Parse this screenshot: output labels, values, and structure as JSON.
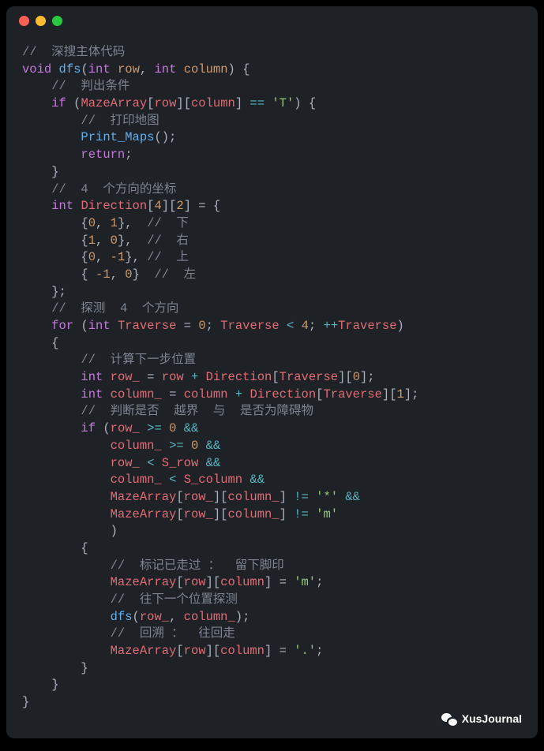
{
  "watermark": "XusJournal",
  "code": {
    "c1": "//  深搜主体代码",
    "l2_void": "void",
    "l2_dfs": "dfs",
    "l2_int1": "int",
    "l2_row": "row",
    "l2_int2": "int",
    "l2_col": "column",
    "c3": "//  判出条件",
    "l4_if": "if",
    "l4_maze": "MazeArray",
    "l4_row": "row",
    "l4_col": "column",
    "l4_eq": "==",
    "l4_t": "'T'",
    "c5": "//  打印地图",
    "l6_print": "Print_Maps",
    "l7_return": "return",
    "c9": "//  4  个方向的坐标",
    "l10_int": "int",
    "l10_dir": "Direction",
    "l10_4": "4",
    "l10_2": "2",
    "l11_0": "0",
    "l11_1": "1",
    "c11": "//  下",
    "l12_1": "1",
    "l12_0": "0",
    "c12": "//  右",
    "l13_0": "0",
    "l13_n1": "-1",
    "c13": "//  上",
    "l14_n1": "-1",
    "l14_0": "0",
    "c14": "//  左",
    "c16": "//  探测  4  个方向",
    "l17_for": "for",
    "l17_int": "int",
    "l17_trav": "Traverse",
    "l17_0": "0",
    "l17_trav2": "Traverse",
    "l17_lt": "<",
    "l17_4": "4",
    "l17_inc": "++",
    "l17_trav3": "Traverse",
    "c19": "//  计算下一步位置",
    "l20_int": "int",
    "l20_row_": "row_",
    "l20_row": "row",
    "l20_plus": "+",
    "l20_dir": "Direction",
    "l20_trav": "Traverse",
    "l20_0": "0",
    "l21_int": "int",
    "l21_col_": "column_",
    "l21_col": "column",
    "l21_plus": "+",
    "l21_dir": "Direction",
    "l21_trav": "Traverse",
    "l21_1": "1",
    "c22": "//  判断是否  越界  与  是否为障碍物",
    "l23_if": "if",
    "l23_row_": "row_",
    "l23_ge": ">=",
    "l23_0": "0",
    "l23_and": "&&",
    "l24_col_": "column_",
    "l24_ge": ">=",
    "l24_0": "0",
    "l24_and": "&&",
    "l25_row_": "row_",
    "l25_lt": "<",
    "l25_srow": "S_row",
    "l25_and": "&&",
    "l26_col_": "column_",
    "l26_lt": "<",
    "l26_scol": "S_column",
    "l26_and": "&&",
    "l27_maze": "MazeArray",
    "l27_row_": "row_",
    "l27_col_": "column_",
    "l27_ne": "!=",
    "l27_star": "'*'",
    "l27_and": "&&",
    "l28_maze": "MazeArray",
    "l28_row_": "row_",
    "l28_col_": "column_",
    "l28_ne": "!=",
    "l28_m": "'m'",
    "c30": "//  标记已走过 ：  留下脚印",
    "l31_maze": "MazeArray",
    "l31_row": "row",
    "l31_col": "column",
    "l31_m": "'m'",
    "c32": "//  往下一个位置探测",
    "l33_dfs": "dfs",
    "l33_row_": "row_",
    "l33_col_": "column_",
    "c34": "//  回溯 ：  往回走",
    "l35_maze": "MazeArray",
    "l35_row": "row",
    "l35_col": "column",
    "l35_dot": "'.'"
  }
}
